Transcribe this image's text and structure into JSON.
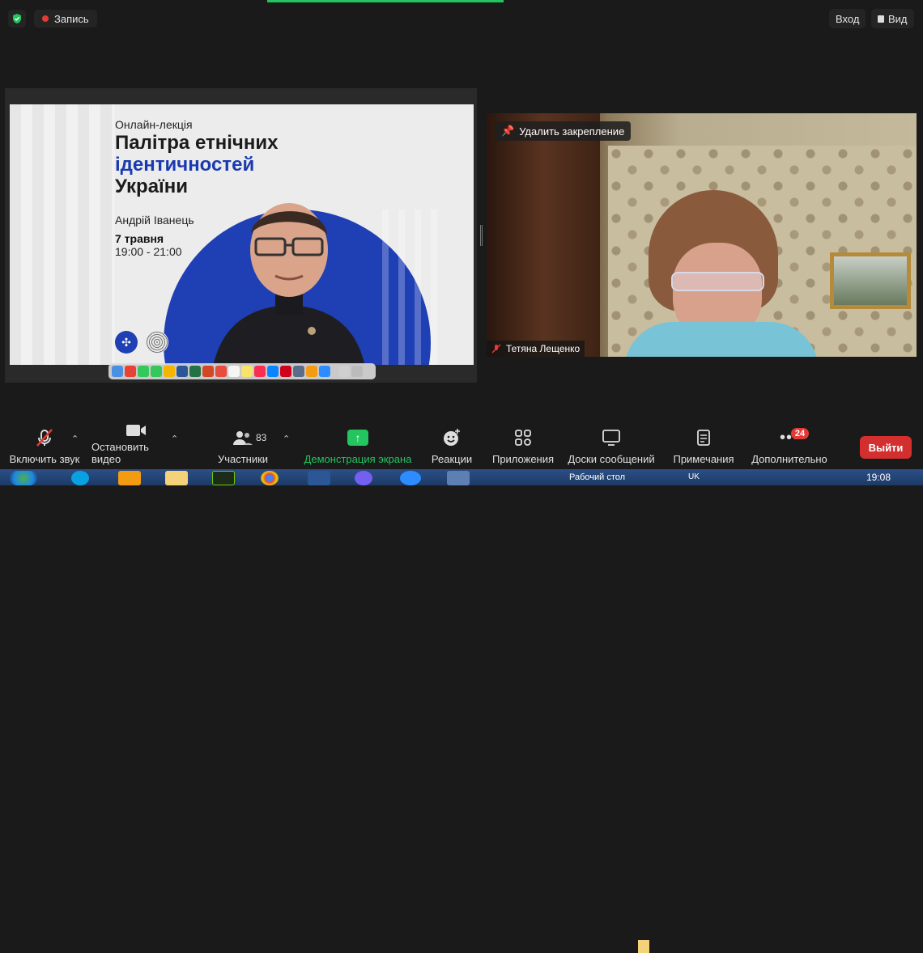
{
  "topbar": {
    "record_label": "Запись",
    "enter_label": "Вход",
    "view_label": "Вид"
  },
  "slide": {
    "kicker": "Онлайн-лекція",
    "title_line1": "Палітра етнічних",
    "title_line2": "ідентичностей",
    "title_line3": "України",
    "author": "Андрій Іванець",
    "date": "7 травня",
    "time": "19:00 - 21:00"
  },
  "video": {
    "unpin_label": "Удалить закрепление",
    "participant_name": "Тетяна Лещенко"
  },
  "toolbar": {
    "unmute_label": "Включить звук",
    "stop_video_label": "Остановить видео",
    "participants_label": "Участники",
    "participants_count": "83",
    "share_label": "Демонстрация экрана",
    "reactions_label": "Реакции",
    "apps_label": "Приложения",
    "whiteboards_label": "Доски сообщений",
    "notes_label": "Примечания",
    "more_label": "Дополнительно",
    "more_badge": "24",
    "leave_label": "Выйти"
  },
  "taskbar": {
    "desktop_label": "Рабочий стол",
    "language": "UK",
    "clock": "19:08"
  },
  "colors": {
    "accent_green": "#22c55e",
    "leave_red": "#d32f2f",
    "slide_blue": "#1f3fb5"
  }
}
